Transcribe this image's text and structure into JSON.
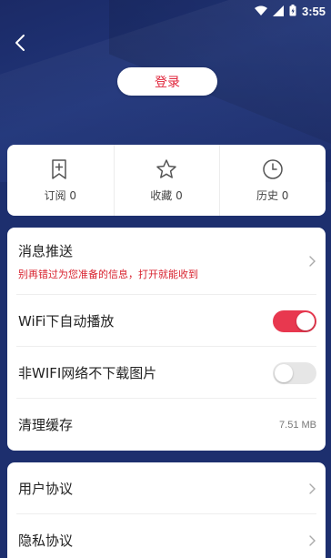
{
  "status_bar": {
    "time": "3:55",
    "icons": [
      "wifi-icon",
      "signal-icon",
      "battery-icon"
    ]
  },
  "header": {
    "back_icon": "chevron-left-icon",
    "login_label": "登录"
  },
  "quick_actions": [
    {
      "id": "subscribe",
      "icon": "bookmark-plus-icon",
      "label": "订阅 0"
    },
    {
      "id": "favorite",
      "icon": "star-icon",
      "label": "收藏 0"
    },
    {
      "id": "history",
      "icon": "clock-icon",
      "label": "历史 0"
    }
  ],
  "settings": {
    "push": {
      "title": "消息推送",
      "subtitle": "别再错过为您准备的信息，打开就能收到"
    },
    "wifi_autoplay": {
      "title": "WiFi下自动播放",
      "enabled": true
    },
    "no_images_non_wifi": {
      "title": "非WIFI网络不下载图片",
      "enabled": false
    },
    "clear_cache": {
      "title": "清理缓存",
      "size": "7.51 MB"
    }
  },
  "legal": {
    "user_agreement": "用户协议",
    "privacy_agreement": "隐私协议"
  },
  "colors": {
    "background": "#1d2f6e",
    "accent": "#e0253b",
    "toggle_on": "#e8384f",
    "toggle_off": "#e6e6e6"
  }
}
